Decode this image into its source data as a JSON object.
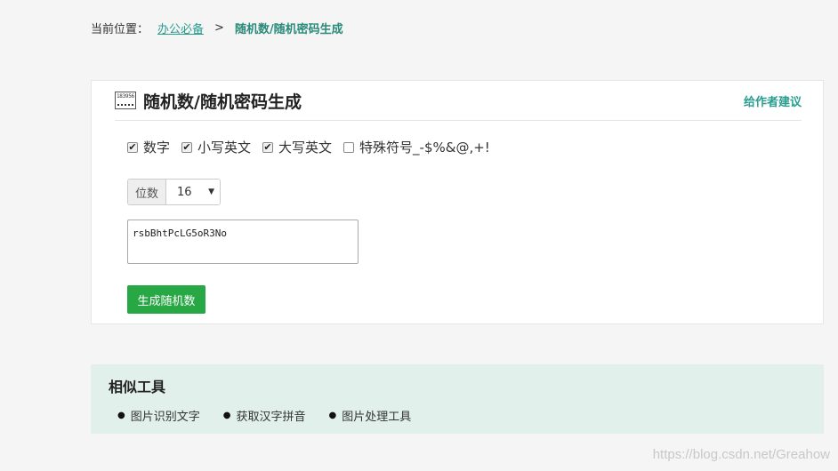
{
  "breadcrumb": {
    "label": "当前位置：",
    "parent": "办公必备",
    "separator": ">",
    "current": "随机数/随机密码生成"
  },
  "card": {
    "icon_text": "183956",
    "title": "随机数/随机密码生成",
    "feedback": "给作者建议"
  },
  "options": [
    {
      "label": "数字",
      "checked": true
    },
    {
      "label": "小写英文",
      "checked": true
    },
    {
      "label": "大写英文",
      "checked": true
    },
    {
      "label": "特殊符号_-$%&@,+!",
      "checked": false
    }
  ],
  "digits": {
    "label": "位数",
    "value": "16"
  },
  "output": {
    "value": "rsbBhtPcLG5oR3No"
  },
  "generate_button": "生成随机数",
  "similar": {
    "title": "相似工具",
    "items": [
      "图片识别文字",
      "获取汉字拼音",
      "图片处理工具"
    ]
  },
  "watermark": "https://blog.csdn.net/Greahow",
  "colors": {
    "accent": "#2a9d8f",
    "button": "#28a745",
    "similar_bg": "#e1f0ea"
  }
}
